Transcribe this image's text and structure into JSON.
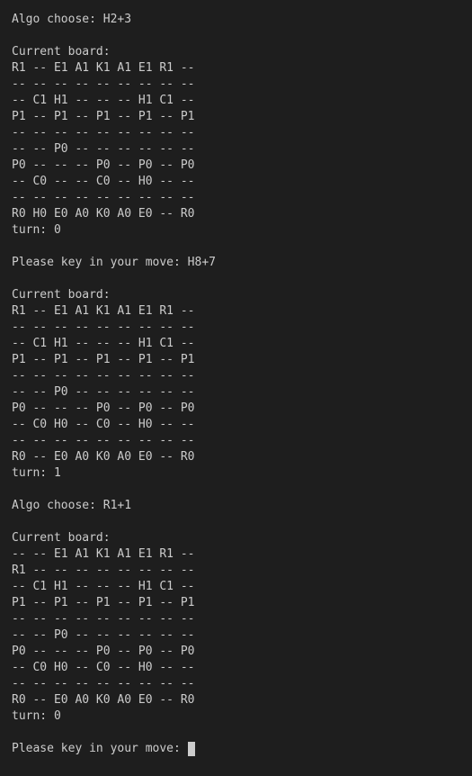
{
  "terminal": {
    "lines": [
      "Algo choose: H2+3",
      "",
      "Current board:",
      "R1 -- E1 A1 K1 A1 E1 R1 --",
      "-- -- -- -- -- -- -- -- --",
      "-- C1 H1 -- -- -- H1 C1 --",
      "P1 -- P1 -- P1 -- P1 -- P1",
      "-- -- -- -- -- -- -- -- --",
      "-- -- P0 -- -- -- -- -- --",
      "P0 -- -- -- P0 -- P0 -- P0",
      "-- C0 -- -- C0 -- H0 -- --",
      "-- -- -- -- -- -- -- -- --",
      "R0 H0 E0 A0 K0 A0 E0 -- R0",
      "turn: 0",
      "",
      "Please key in your move: H8+7",
      "",
      "Current board:",
      "R1 -- E1 A1 K1 A1 E1 R1 --",
      "-- -- -- -- -- -- -- -- --",
      "-- C1 H1 -- -- -- H1 C1 --",
      "P1 -- P1 -- P1 -- P1 -- P1",
      "-- -- -- -- -- -- -- -- --",
      "-- -- P0 -- -- -- -- -- --",
      "P0 -- -- -- P0 -- P0 -- P0",
      "-- C0 H0 -- C0 -- H0 -- --",
      "-- -- -- -- -- -- -- -- --",
      "R0 -- E0 A0 K0 A0 E0 -- R0",
      "turn: 1",
      "",
      "Algo choose: R1+1",
      "",
      "Current board:",
      "-- -- E1 A1 K1 A1 E1 R1 --",
      "R1 -- -- -- -- -- -- -- --",
      "-- C1 H1 -- -- -- H1 C1 --",
      "P1 -- P1 -- P1 -- P1 -- P1",
      "-- -- -- -- -- -- -- -- --",
      "-- -- P0 -- -- -- -- -- --",
      "P0 -- -- -- P0 -- P0 -- P0",
      "-- C0 H0 -- C0 -- H0 -- --",
      "-- -- -- -- -- -- -- -- --",
      "R0 -- E0 A0 K0 A0 E0 -- R0",
      "turn: 0",
      ""
    ],
    "prompt": "Please key in your move: ",
    "input_value": ""
  }
}
